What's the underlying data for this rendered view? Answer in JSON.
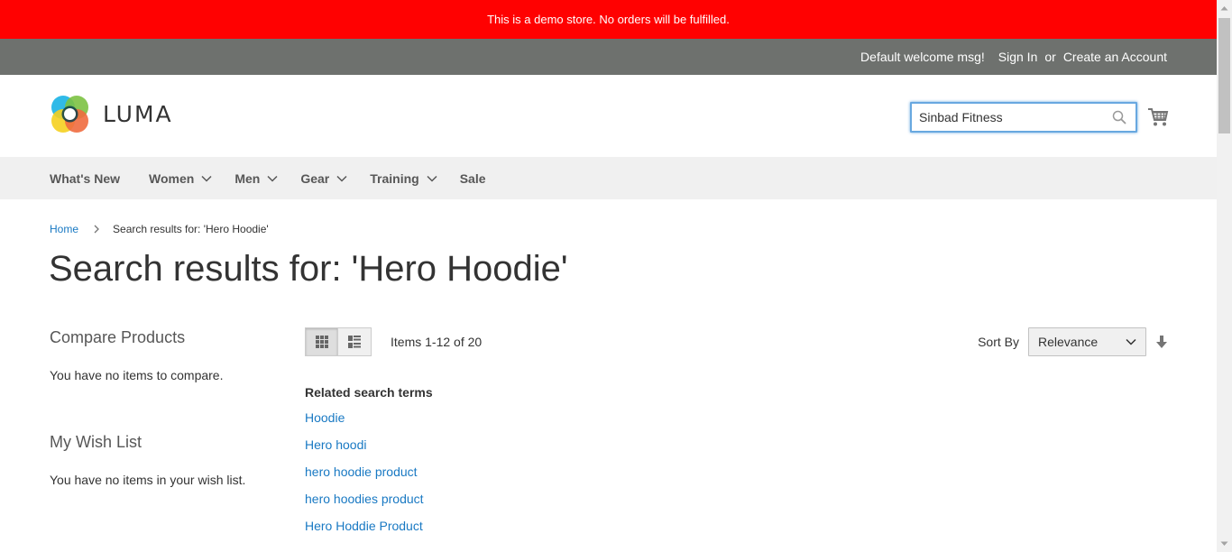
{
  "notice": "This is a demo store. No orders will be fulfilled.",
  "header_links": {
    "welcome": "Default welcome msg!",
    "sign_in": "Sign In",
    "or": "or",
    "create_account": "Create an Account"
  },
  "logo": {
    "text": "LUMA"
  },
  "search": {
    "value": "Sinbad Fitness",
    "icon": "search-icon"
  },
  "cart": {
    "icon": "cart-icon"
  },
  "nav": {
    "items": [
      {
        "label": "What's New",
        "has_dropdown": false
      },
      {
        "label": "Women",
        "has_dropdown": true
      },
      {
        "label": "Men",
        "has_dropdown": true
      },
      {
        "label": "Gear",
        "has_dropdown": true
      },
      {
        "label": "Training",
        "has_dropdown": true
      },
      {
        "label": "Sale",
        "has_dropdown": false
      }
    ]
  },
  "breadcrumb": {
    "home": "Home",
    "current": "Search results for: 'Hero Hoodie'"
  },
  "page_title": "Search results for: 'Hero Hoodie'",
  "sidebar": {
    "compare_title": "Compare Products",
    "compare_text": "You have no items to compare.",
    "wishlist_title": "My Wish List",
    "wishlist_text": "You have no items in your wish list."
  },
  "toolbar": {
    "amount": "Items 1-12 of 20",
    "sort_label": "Sort By",
    "sort_value": "Relevance",
    "active_mode": "grid"
  },
  "related": {
    "title": "Related search terms",
    "terms": [
      "Hoodie",
      "Hero hoodi",
      "hero hoodie product",
      "hero hoodies product",
      "Hero Hoddie Product"
    ]
  },
  "colors": {
    "notice_bg": "#ff0101",
    "panel_bg": "#6e716e",
    "nav_bg": "#f0f0f0",
    "link": "#1979c3"
  }
}
